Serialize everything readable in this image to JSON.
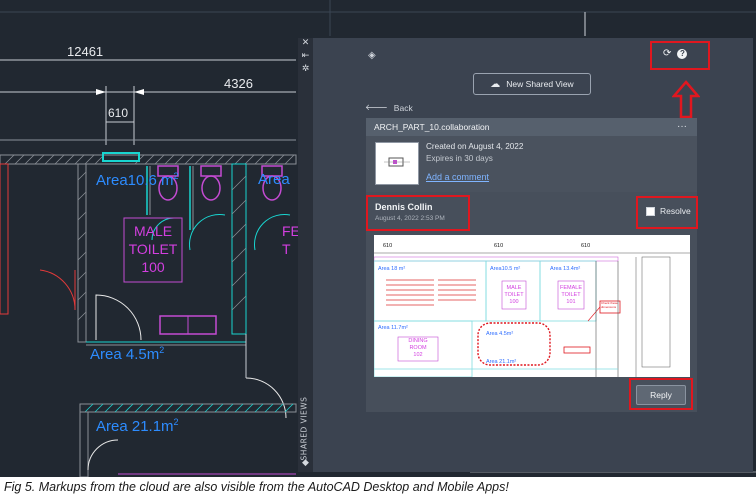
{
  "drawing": {
    "dims": {
      "d1": "12461",
      "d2": "4326",
      "d3": "610"
    },
    "rooms": {
      "area_top": "Area10.6 m",
      "area_top_sup": "2",
      "area_cut": "Area",
      "male": [
        "MALE",
        "TOILET",
        "100"
      ],
      "female_cut": [
        "FE",
        "T"
      ],
      "area_mid": "Area 4.5m",
      "area_mid_sup": "2",
      "area_bottom": "Area 21.1m",
      "area_bottom_sup": "2"
    }
  },
  "palette": {
    "side_label": "SHARED VIEWS",
    "strip_icons": [
      "close-icon",
      "collapse-icon",
      "settings-icon"
    ],
    "new_shared_view": "New Shared View",
    "back_label": "Back",
    "view": {
      "name": "ARCH_PART_10.collaboration",
      "created": "Created on August 4, 2022",
      "expires": "Expires in 30 days",
      "add_comment": "Add a comment"
    },
    "comment": {
      "author": "Dennis Collin",
      "timestamp": "August 4, 2022 2:53 PM",
      "resolve_label": "Resolve",
      "reply_label": "Reply"
    },
    "markup_image": {
      "dim_labels": [
        "610",
        "610",
        "610"
      ],
      "rooms": [
        {
          "text": "Area 18 m²"
        },
        {
          "text": "Area10.5 m²"
        },
        {
          "text": "Area 13.4m²"
        },
        {
          "text": "MALE"
        },
        {
          "text": "TOILET"
        },
        {
          "text": "100"
        },
        {
          "text": "FEMALE"
        },
        {
          "text": "TOILET"
        },
        {
          "text": "101"
        },
        {
          "text": "Area 11.7m²"
        },
        {
          "text": "Area 4.5m²"
        },
        {
          "text": "DINING"
        },
        {
          "text": "ROOM"
        },
        {
          "text": "102"
        },
        {
          "text": "Area 21.1m²"
        }
      ],
      "note_text": "Check these dimensions"
    },
    "accent_red": "#e0171f"
  },
  "caption": "Fig 5. Markups from the cloud are also visible from the AutoCAD Desktop and Mobile Apps!"
}
